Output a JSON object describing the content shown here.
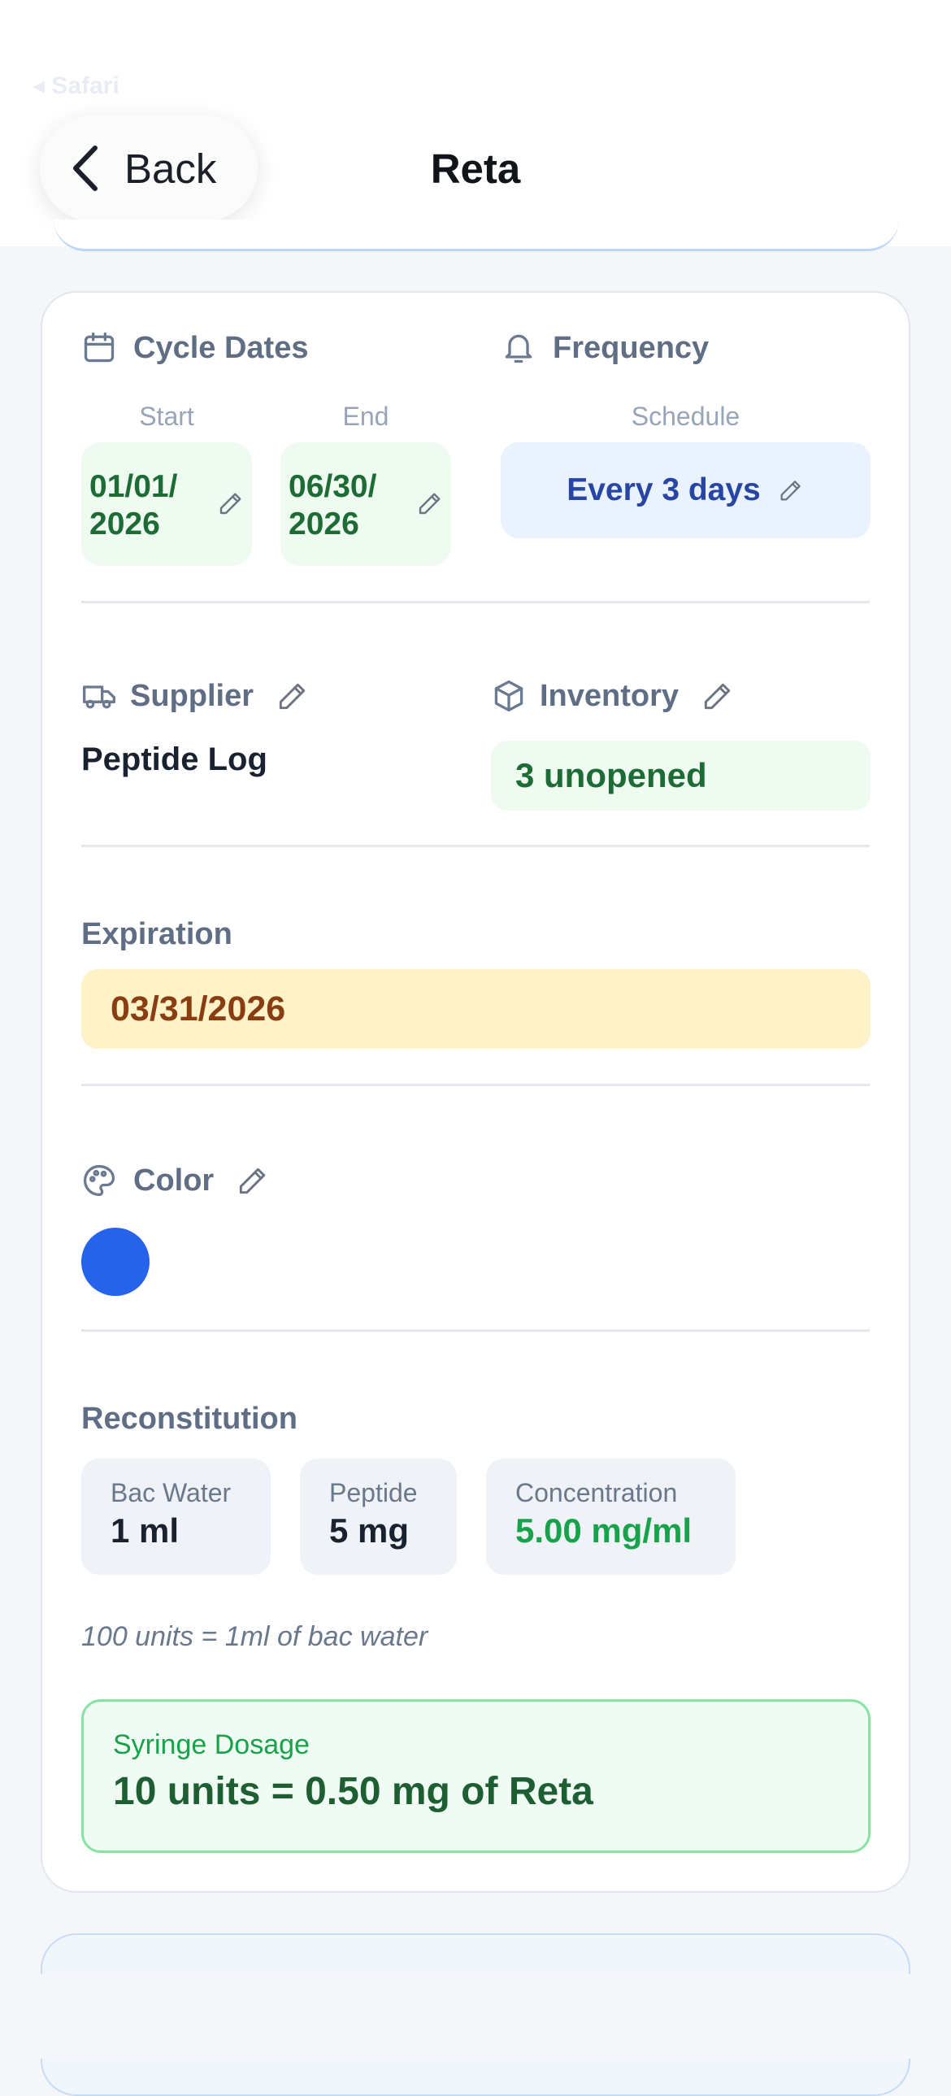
{
  "status_bar": {
    "back_app": "◂ Safari"
  },
  "nav": {
    "back_label": "Back",
    "title": "Reta"
  },
  "cycle_dates": {
    "heading": "Cycle Dates",
    "start_label": "Start",
    "start_value": "01/01/ 2026",
    "end_label": "End",
    "end_value": "06/30/ 2026"
  },
  "frequency": {
    "heading": "Frequency",
    "schedule_label": "Schedule",
    "schedule_value": "Every 3 days"
  },
  "supplier": {
    "heading": "Supplier",
    "value": "Peptide Log"
  },
  "inventory": {
    "heading": "Inventory",
    "value": "3 unopened"
  },
  "expiration": {
    "heading": "Expiration",
    "value": "03/31/2026"
  },
  "color": {
    "heading": "Color",
    "swatch": "#2563eb"
  },
  "reconstitution": {
    "heading": "Reconstitution",
    "bac_water_label": "Bac Water",
    "bac_water_value": "1 ml",
    "peptide_label": "Peptide",
    "peptide_value": "5 mg",
    "concentration_label": "Concentration",
    "concentration_value": "5.00 mg/ml",
    "note": "100 units = 1ml of bac water"
  },
  "syringe_dosage": {
    "label": "Syringe Dosage",
    "value": "10 units = 0.50 mg of Reta"
  },
  "icons": {
    "back": "chevron-left-icon",
    "cycle": "calendar-icon",
    "frequency": "bell-icon",
    "supplier": "truck-icon",
    "inventory": "package-icon",
    "color": "palette-icon",
    "edit": "pencil-icon"
  }
}
